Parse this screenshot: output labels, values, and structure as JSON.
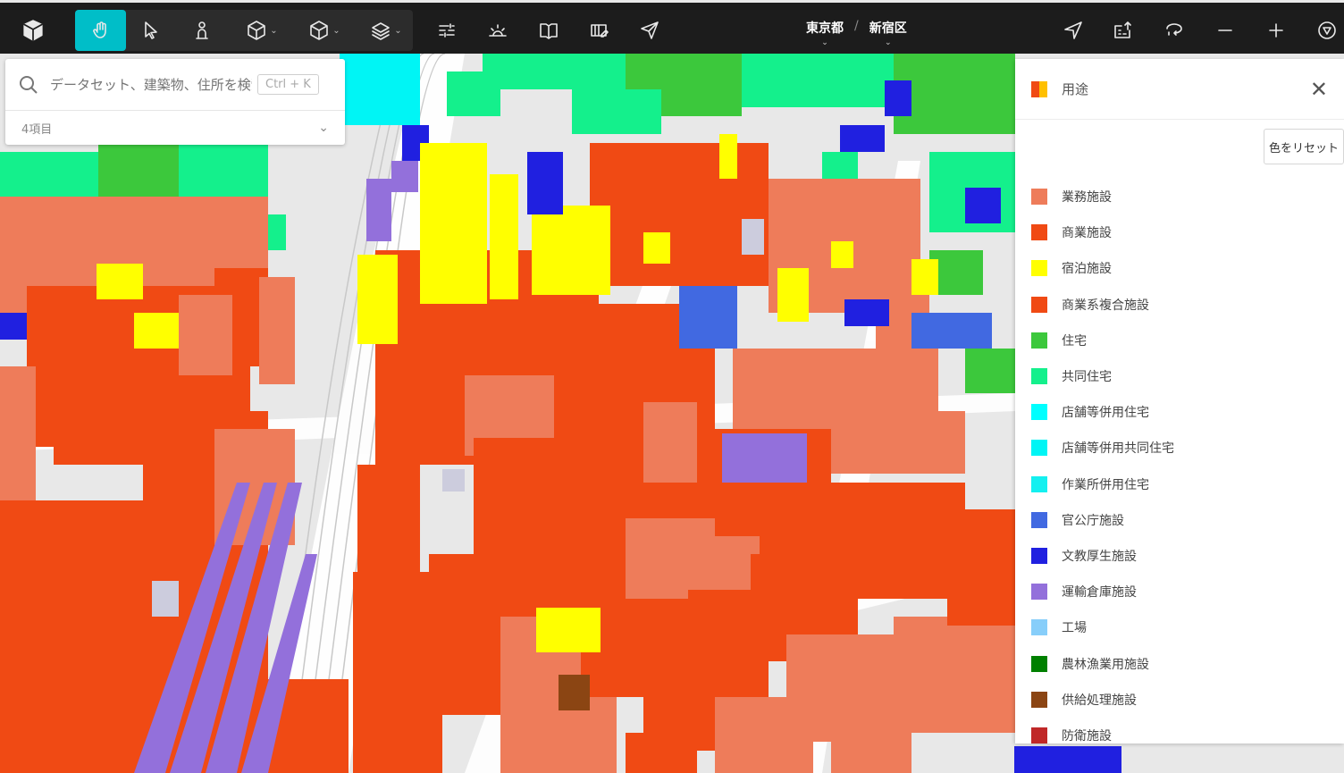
{
  "toolbar": {
    "tools": [
      {
        "name": "pan-tool",
        "active": true
      },
      {
        "name": "select-tool"
      },
      {
        "name": "pedestrian-tool"
      },
      {
        "name": "box-tool",
        "dropdown": true
      },
      {
        "name": "box-id-tool",
        "dropdown": true
      },
      {
        "name": "layers-tool",
        "dropdown": true
      }
    ]
  },
  "breadcrumb": {
    "prefecture": "東京都",
    "separator": "/",
    "ward": "新宿区"
  },
  "search": {
    "placeholder": "データセット、建築物、住所を検索",
    "shortcut": "Ctrl + K",
    "count_label": "4項目"
  },
  "legend": {
    "title": "用途",
    "reset_label": "色をリセット",
    "items": [
      {
        "label": "業務施設",
        "color": "#ee7c5a"
      },
      {
        "label": "商業施設",
        "color": "#f04a14"
      },
      {
        "label": "宿泊施設",
        "color": "#ffff00"
      },
      {
        "label": "商業系複合施設",
        "color": "#f04a14"
      },
      {
        "label": "住宅",
        "color": "#3cc83c"
      },
      {
        "label": "共同住宅",
        "color": "#14f08c"
      },
      {
        "label": "店舗等併用住宅",
        "color": "#00ffff"
      },
      {
        "label": "店舗等併用共同住宅",
        "color": "#00f5f5"
      },
      {
        "label": "作業所併用住宅",
        "color": "#14f0f0"
      },
      {
        "label": "官公庁施設",
        "color": "#4169e1"
      },
      {
        "label": "文教厚生施設",
        "color": "#2020e0"
      },
      {
        "label": "運輸倉庫施設",
        "color": "#9370db"
      },
      {
        "label": "工場",
        "color": "#87cefa"
      },
      {
        "label": "農林漁業用施設",
        "color": "#008000"
      },
      {
        "label": "供給処理施設",
        "color": "#8b4513"
      },
      {
        "label": "防衛施設",
        "color": "#c02828"
      }
    ]
  },
  "map": {
    "colors": {
      "ground": "#e8e8e8",
      "road": "#ffffff",
      "rail": "#d6d6d6"
    }
  }
}
